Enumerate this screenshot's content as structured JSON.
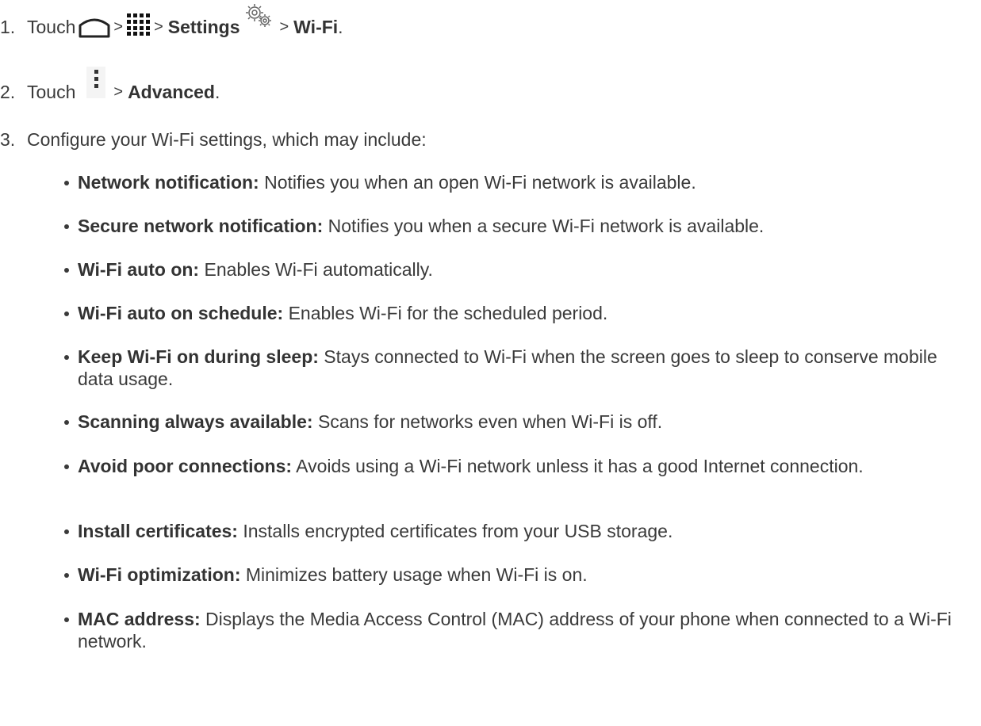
{
  "steps": [
    {
      "number": "1.",
      "touch": "Touch",
      "sep1": ">",
      "sep2": ">",
      "settings": "Settings",
      "sep3": ">",
      "wifi": "Wi-Fi",
      "end": ".",
      "icons": [
        "home-icon",
        "apps-grid-icon",
        "settings-gear-icon"
      ]
    },
    {
      "number": "2.",
      "touch": "Touch",
      "sep": ">",
      "advanced": "Advanced",
      "end": ".",
      "icons": [
        "menu-overflow-icon"
      ]
    },
    {
      "number": "3.",
      "text": "Configure your Wi-Fi settings, which may include:"
    }
  ],
  "bullets": [
    {
      "title": "Network notification:",
      "text": " Notifies you when an open Wi-Fi network is available."
    },
    {
      "title": "Secure network notification:",
      "text": " Notifies you when a secure Wi-Fi network is available."
    },
    {
      "title": "Wi-Fi auto on:",
      "text": " Enables Wi-Fi automatically."
    },
    {
      "title": "Wi-Fi auto on schedule:",
      "text": " Enables Wi-Fi for the scheduled period."
    },
    {
      "title": "Keep Wi-Fi on during sleep:",
      "text": " Stays connected to Wi-Fi when the screen goes to sleep to conserve mobile data usage."
    },
    {
      "title": "Scanning always available:",
      "text": " Scans for networks even when Wi-Fi is off."
    },
    {
      "title": "Avoid poor connections:",
      "text": " Avoids using a Wi-Fi network unless it has a good Internet connection."
    },
    {
      "title": "Install certificates:",
      "text": " Installs encrypted certificates from your USB storage."
    },
    {
      "title": "Wi-Fi optimization:",
      "text": " Minimizes battery usage when Wi-Fi is on."
    },
    {
      "title": "MAC address:",
      "text": " Displays the Media Access Control (MAC) address of your phone when connected to a Wi-Fi network."
    }
  ]
}
